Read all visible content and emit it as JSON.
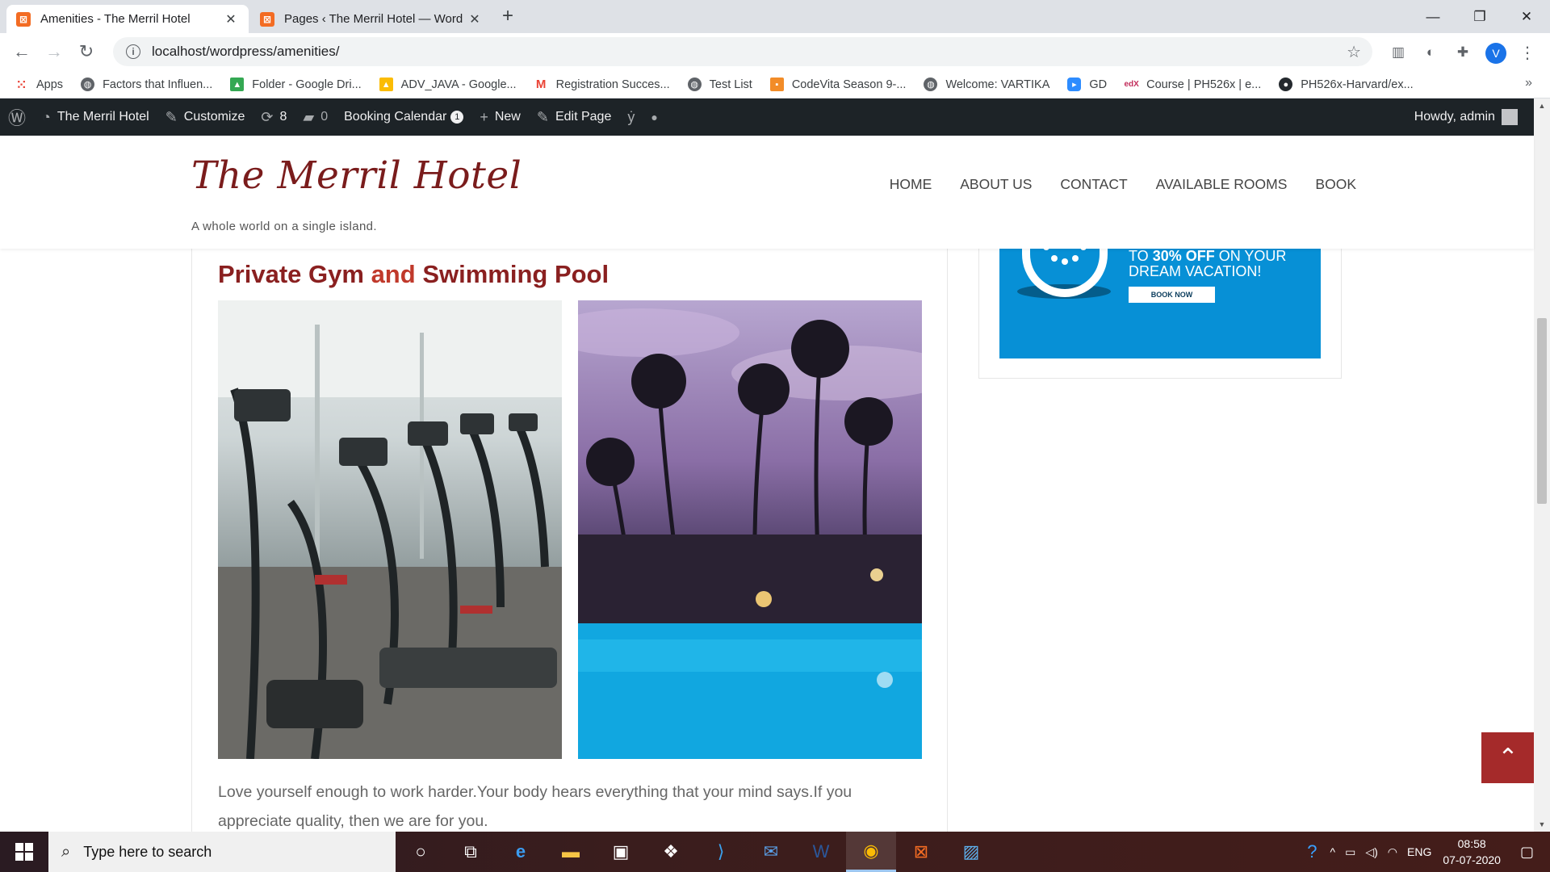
{
  "browser": {
    "tabs": [
      {
        "title": "Amenities - The Merril Hotel",
        "active": true
      },
      {
        "title": "Pages ‹ The Merril Hotel — Word",
        "active": false
      }
    ],
    "url": "localhost/wordpress/amenities/",
    "profile_initial": "V",
    "bookmarks": [
      {
        "label": "Apps",
        "icon": "apps-grid-icon",
        "color": "#e94235"
      },
      {
        "label": "Factors that Influen...",
        "icon": "globe-icon",
        "color": "#5f6368"
      },
      {
        "label": "Folder - Google Dri...",
        "icon": "google-drive-icon",
        "color": "#34a853"
      },
      {
        "label": "ADV_JAVA - Google...",
        "icon": "google-drive-icon",
        "color": "#fbbc04"
      },
      {
        "label": "Registration Succes...",
        "icon": "gmail-icon",
        "color": "#ea4335"
      },
      {
        "label": "Test List",
        "icon": "globe-icon",
        "color": "#5f6368"
      },
      {
        "label": "CodeVita Season 9-...",
        "icon": "codevita-icon",
        "color": "#f28c28"
      },
      {
        "label": "Welcome: VARTIKA",
        "icon": "globe-icon",
        "color": "#5f6368"
      },
      {
        "label": "GD",
        "icon": "zoom-icon",
        "color": "#2d8cff"
      },
      {
        "label": "Course | PH526x | e...",
        "icon": "edx-icon",
        "color": "#c22d5b"
      },
      {
        "label": "PH526x-Harvard/ex...",
        "icon": "github-icon",
        "color": "#24292e"
      }
    ]
  },
  "adminbar": {
    "site": "The Merril Hotel",
    "customize": "Customize",
    "updates": "8",
    "comments": "0",
    "booking": "Booking Calendar",
    "booking_badge": "1",
    "new": "New",
    "edit": "Edit Page",
    "howdy": "Howdy, admin"
  },
  "site": {
    "title": "The Merril Hotel",
    "tagline": "A whole world on a single island.",
    "menu": [
      "HOME",
      "ABOUT US",
      "CONTACT",
      "AVAILABLE ROOMS",
      "BOOK"
    ]
  },
  "content": {
    "heading_part1": "Private Gym",
    "heading_and": "and",
    "heading_part2": "Swimming Pool",
    "paragraph": "Love yourself enough to work harder.Your body hears everything that your mind says.If you appreciate quality, then we are for you."
  },
  "sidebar": {
    "promo_prefix": "TO",
    "promo_bold": "30% OFF",
    "promo_rest": "ON YOUR",
    "promo_line2": "DREAM VACATION!",
    "promo_button": "BOOK NOW",
    "promo_color": "#0790d6"
  },
  "taskbar": {
    "search_placeholder": "Type here to search",
    "lang": "ENG",
    "time": "08:58",
    "date": "07-07-2020"
  },
  "colors": {
    "title": "#7a1c1c",
    "heading": "#8a2020",
    "and": "#c0392b",
    "totop": "#a52a2a"
  }
}
